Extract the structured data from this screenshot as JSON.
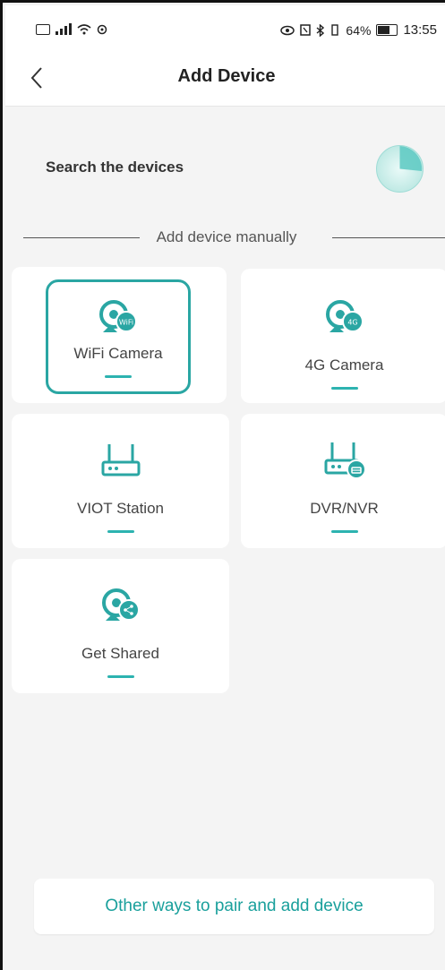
{
  "status_bar": {
    "percent": "64%",
    "time": "13:55"
  },
  "header": {
    "title": "Add Device"
  },
  "search": {
    "label": "Search the devices"
  },
  "divider": {
    "label": "Add device manually"
  },
  "devices": [
    {
      "label": "WiFi Camera",
      "icon": "wifi-camera-icon",
      "badge": "WiFi",
      "selected": true
    },
    {
      "label": "4G Camera",
      "icon": "4g-camera-icon",
      "badge": "4G",
      "selected": false
    },
    {
      "label": "VIOT Station",
      "icon": "station-icon",
      "selected": false
    },
    {
      "label": "DVR/NVR",
      "icon": "dvr-nvr-icon",
      "selected": false
    },
    {
      "label": "Get Shared",
      "icon": "shared-camera-icon",
      "selected": false
    }
  ],
  "footer": {
    "other_ways_label": "Other ways to pair and add device"
  },
  "colors": {
    "accent": "#2aa6a3",
    "background": "#f4f4f4"
  }
}
